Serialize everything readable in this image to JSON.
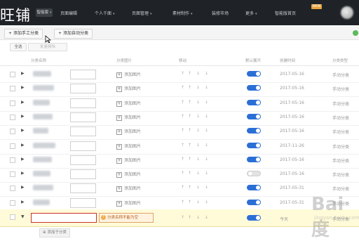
{
  "nav": {
    "logo": "旺铺",
    "selector": "智能版",
    "items": [
      "页面编辑",
      "个人千面",
      "页面管理",
      "素材制作",
      "装修市场",
      "更多",
      "智能版首页"
    ],
    "badge": "NEW"
  },
  "toolbar": {
    "add_manual": "添加手工分类",
    "add_auto": "添加自动分类"
  },
  "selbar": {
    "select_all": "全选",
    "batch": "批量删除"
  },
  "columns": [
    "分类名称",
    "分类图片",
    "移动",
    "默认展开",
    "创建时间",
    "分类类型"
  ],
  "add_image": "添加图片",
  "move_icons": [
    "↑",
    "↑",
    "↓",
    "↓"
  ],
  "rows": [
    {
      "date": "2017-05-16",
      "type": "手动分类",
      "expanded": true
    },
    {
      "date": "2017-05-16",
      "type": "手动分类",
      "expanded": true
    },
    {
      "date": "2017-05-16",
      "type": "手动分类",
      "expanded": true
    },
    {
      "date": "2017-05-16",
      "type": "手动分类",
      "expanded": true
    },
    {
      "date": "2017-05-16",
      "type": "手动分类",
      "expanded": true
    },
    {
      "date": "2017-11-26",
      "type": "手动分类",
      "expanded": true
    },
    {
      "date": "2017-05-16",
      "type": "手动分类",
      "expanded": true
    },
    {
      "date": "2017-05-16",
      "type": "手动分类",
      "expanded": false
    },
    {
      "date": "2017-05-31",
      "type": "手动分类",
      "expanded": true
    },
    {
      "date": "2017-05-31",
      "type": "手动分类",
      "expanded": true
    }
  ],
  "edit_row": {
    "error": "分类名称不能为空",
    "date": "今天",
    "type": "手动分类",
    "expanded": true
  },
  "add_child": "添加子分类",
  "watermark": {
    "main": "Bai度",
    "sub": "jingyan.baidu.com"
  },
  "colors": {
    "nav_bg": "#1f2327",
    "toggle_on": "#2b6fd6",
    "edit_bg": "#fffbd9",
    "error_border": "#c9302c"
  }
}
